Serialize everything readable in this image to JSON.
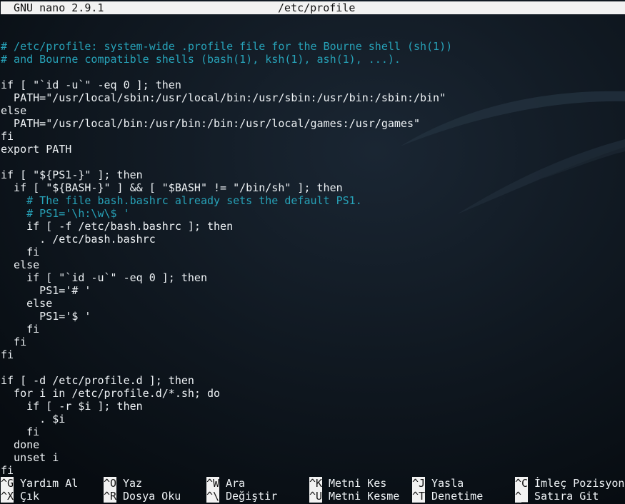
{
  "window": {
    "app": "GNU nano 2.9.1",
    "file": "/etc/profile"
  },
  "colors": {
    "background": "#0b1219",
    "comment": "#27a2b8",
    "text": "#eef2f5",
    "titlebar": "#f2f2f2"
  },
  "editor": {
    "lines": [
      {
        "text": "",
        "kind": "code"
      },
      {
        "text": "# /etc/profile: system-wide .profile file for the Bourne shell (sh(1))",
        "kind": "comment"
      },
      {
        "text": "# and Bourne compatible shells (bash(1), ksh(1), ash(1), ...).",
        "kind": "comment"
      },
      {
        "text": "",
        "kind": "code"
      },
      {
        "text": "if [ \"`id -u`\" -eq 0 ]; then",
        "kind": "code"
      },
      {
        "text": "  PATH=\"/usr/local/sbin:/usr/local/bin:/usr/sbin:/usr/bin:/sbin:/bin\"",
        "kind": "code"
      },
      {
        "text": "else",
        "kind": "code"
      },
      {
        "text": "  PATH=\"/usr/local/bin:/usr/bin:/bin:/usr/local/games:/usr/games\"",
        "kind": "code"
      },
      {
        "text": "fi",
        "kind": "code"
      },
      {
        "text": "export PATH",
        "kind": "code"
      },
      {
        "text": "",
        "kind": "code"
      },
      {
        "text": "if [ \"${PS1-}\" ]; then",
        "kind": "code"
      },
      {
        "text": "  if [ \"${BASH-}\" ] && [ \"$BASH\" != \"/bin/sh\" ]; then",
        "kind": "code"
      },
      {
        "text": "    # The file bash.bashrc already sets the default PS1.",
        "kind": "comment"
      },
      {
        "text": "    # PS1='\\h:\\w\\$ '",
        "kind": "comment"
      },
      {
        "text": "    if [ -f /etc/bash.bashrc ]; then",
        "kind": "code"
      },
      {
        "text": "      . /etc/bash.bashrc",
        "kind": "code"
      },
      {
        "text": "    fi",
        "kind": "code"
      },
      {
        "text": "  else",
        "kind": "code"
      },
      {
        "text": "    if [ \"`id -u`\" -eq 0 ]; then",
        "kind": "code"
      },
      {
        "text": "      PS1='# '",
        "kind": "code"
      },
      {
        "text": "    else",
        "kind": "code"
      },
      {
        "text": "      PS1='$ '",
        "kind": "code"
      },
      {
        "text": "    fi",
        "kind": "code"
      },
      {
        "text": "  fi",
        "kind": "code"
      },
      {
        "text": "fi",
        "kind": "code"
      },
      {
        "text": "",
        "kind": "code"
      },
      {
        "text": "if [ -d /etc/profile.d ]; then",
        "kind": "code"
      },
      {
        "text": "  for i in /etc/profile.d/*.sh; do",
        "kind": "code"
      },
      {
        "text": "    if [ -r $i ]; then",
        "kind": "code"
      },
      {
        "text": "      . $i",
        "kind": "code"
      },
      {
        "text": "    fi",
        "kind": "code"
      },
      {
        "text": "  done",
        "kind": "code"
      },
      {
        "text": "  unset i",
        "kind": "code"
      },
      {
        "text": "fi",
        "kind": "code"
      }
    ]
  },
  "shortcuts": {
    "row1": [
      {
        "key": "^G",
        "label": "Yardım Al",
        "name": "help"
      },
      {
        "key": "^O",
        "label": "Yaz",
        "name": "write-out"
      },
      {
        "key": "^W",
        "label": "Ara",
        "name": "where-is"
      },
      {
        "key": "^K",
        "label": "Metni Kes",
        "name": "cut-text"
      },
      {
        "key": "^J",
        "label": "Yasla",
        "name": "justify"
      },
      {
        "key": "^C",
        "label": "İmleç Pozisyonu",
        "name": "cursor-position"
      }
    ],
    "row2": [
      {
        "key": "^X",
        "label": "Çık",
        "name": "exit"
      },
      {
        "key": "^R",
        "label": "Dosya Oku",
        "name": "read-file"
      },
      {
        "key": "^\\",
        "label": "Değiştir",
        "name": "replace"
      },
      {
        "key": "^U",
        "label": "Metni Kesme",
        "name": "uncut-text"
      },
      {
        "key": "^T",
        "label": "Denetime",
        "name": "to-spell"
      },
      {
        "key": "^_",
        "label": "Satıra Git",
        "name": "go-to-line"
      }
    ]
  }
}
